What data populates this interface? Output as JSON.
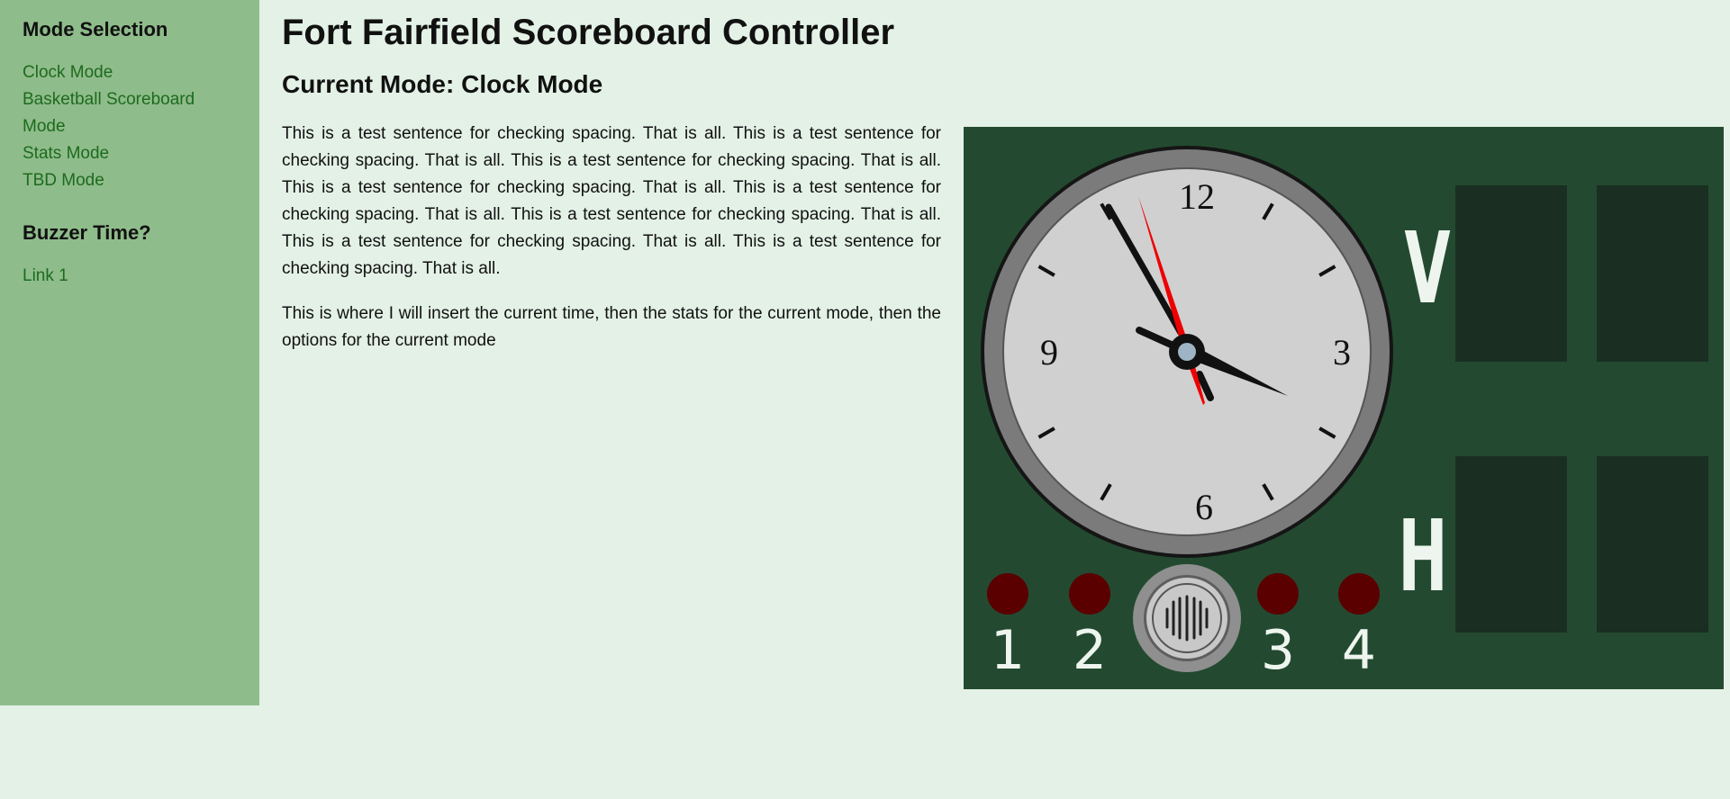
{
  "sidebar": {
    "heading": "Mode Selection",
    "modes": [
      {
        "label": "Clock Mode"
      },
      {
        "label": "Basketball Scoreboard Mode"
      },
      {
        "label": "Stats Mode"
      },
      {
        "label": "TBD Mode"
      }
    ],
    "buzzer_heading": "Buzzer Time?",
    "links": [
      {
        "label": "Link 1"
      }
    ]
  },
  "main": {
    "title": "Fort Fairfield Scoreboard Controller",
    "current_mode": "Current Mode: Clock Mode",
    "paragraph1": "This is a test sentence for checking spacing. That is all. This is a test sentence for checking spacing. That is all. This is a test sentence for checking spacing. That is all. This is a test sentence for checking spacing. That is all. This is a test sentence for checking spacing. That is all. This is a test sentence for checking spacing. That is all. This is a test sentence for checking spacing. That is all. This is a test sentence for checking spacing. That is all.",
    "paragraph2": "This is where I will insert the current time, then the stats for the current mode, then the options for the current mode"
  },
  "scoreboard": {
    "clock_numerals": {
      "n12": "12",
      "n3": "3",
      "n6": "6",
      "n9": "9"
    },
    "team_labels": {
      "visitor": "V",
      "home": "H"
    },
    "period_labels": [
      "1",
      "2",
      "3",
      "4"
    ],
    "horn_icon": "horn-speaker-icon",
    "colors": {
      "board": "#234a30",
      "digit_panel": "#1a2e22",
      "clock_face": "#d0d0d0",
      "clock_rim": "#7b7b7b",
      "second_hand": "#ee0000",
      "period_light": "#5a0000",
      "label_text": "#eef5ee"
    }
  }
}
